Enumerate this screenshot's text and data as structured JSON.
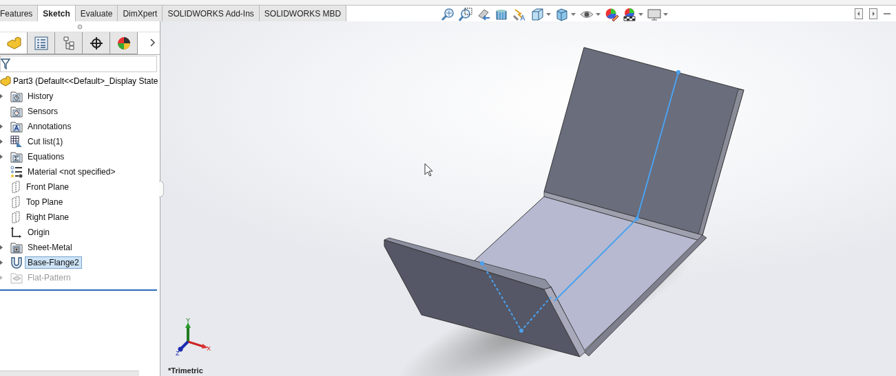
{
  "command_tabs": [
    {
      "label": "Features",
      "selected": false
    },
    {
      "label": "Sketch",
      "selected": true
    },
    {
      "label": "Evaluate",
      "selected": false
    },
    {
      "label": "DimXpert",
      "selected": false
    },
    {
      "label": "SOLIDWORKS Add-Ins",
      "selected": false
    },
    {
      "label": "SOLIDWORKS MBD",
      "selected": false
    }
  ],
  "panel_tabs": [
    {
      "kind": "features",
      "selected": true
    },
    {
      "kind": "properties",
      "selected": false
    },
    {
      "kind": "configurations",
      "selected": false
    },
    {
      "kind": "dimxpert",
      "selected": false
    },
    {
      "kind": "display",
      "selected": false
    }
  ],
  "tree": {
    "label": "Part3  (Default<<Default>_Display State",
    "kind": "part",
    "children": [
      {
        "label": "History",
        "kind": "history",
        "expandable": true,
        "selected": false,
        "disabled": false
      },
      {
        "label": "Sensors",
        "kind": "sensors",
        "expandable": false,
        "selected": false,
        "disabled": false
      },
      {
        "label": "Annotations",
        "kind": "annotations",
        "expandable": true,
        "selected": false,
        "disabled": false
      },
      {
        "label": "Cut list(1)",
        "kind": "cutlist",
        "expandable": true,
        "selected": false,
        "disabled": false
      },
      {
        "label": "Equations",
        "kind": "equations",
        "expandable": true,
        "selected": false,
        "disabled": false
      },
      {
        "label": "Material <not specified>",
        "kind": "material",
        "expandable": false,
        "selected": false,
        "disabled": false
      },
      {
        "label": "Front Plane",
        "kind": "plane",
        "expandable": false,
        "selected": false,
        "disabled": false
      },
      {
        "label": "Top Plane",
        "kind": "plane",
        "expandable": false,
        "selected": false,
        "disabled": false
      },
      {
        "label": "Right Plane",
        "kind": "plane",
        "expandable": false,
        "selected": false,
        "disabled": false
      },
      {
        "label": "Origin",
        "kind": "origin",
        "expandable": false,
        "selected": false,
        "disabled": false
      },
      {
        "label": "Sheet-Metal",
        "kind": "sheetmetal",
        "expandable": true,
        "selected": false,
        "disabled": false
      },
      {
        "label": "Base-Flange2",
        "kind": "flange",
        "expandable": true,
        "selected": true,
        "disabled": false
      },
      {
        "label": "Flat-Pattern",
        "kind": "flatpattern",
        "expandable": true,
        "selected": false,
        "disabled": true
      }
    ]
  },
  "viewport": {
    "view_label": "*Trimetric",
    "triad": {
      "x": "X",
      "y": "Y",
      "z": "Z"
    }
  }
}
